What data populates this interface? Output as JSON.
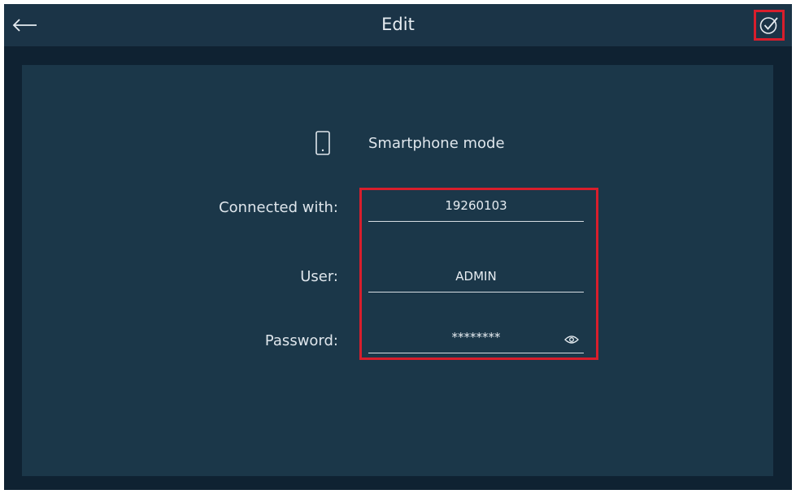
{
  "header": {
    "title": "Edit",
    "back_icon": "arrow-left-icon",
    "confirm_icon": "check-circle-icon"
  },
  "mode": {
    "icon": "smartphone-icon",
    "label": "Smartphone mode"
  },
  "form": {
    "connected_with": {
      "label": "Connected with:",
      "value": "19260103"
    },
    "user": {
      "label": "User:",
      "value": "ADMIN"
    },
    "password": {
      "label": "Password:",
      "value": "********",
      "toggle_icon": "eye-icon"
    }
  },
  "colors": {
    "background": "#0f2232",
    "header": "#1b3447",
    "panel": "#1b3749",
    "text": "#e6ecf1",
    "highlight": "#d81e2c"
  }
}
